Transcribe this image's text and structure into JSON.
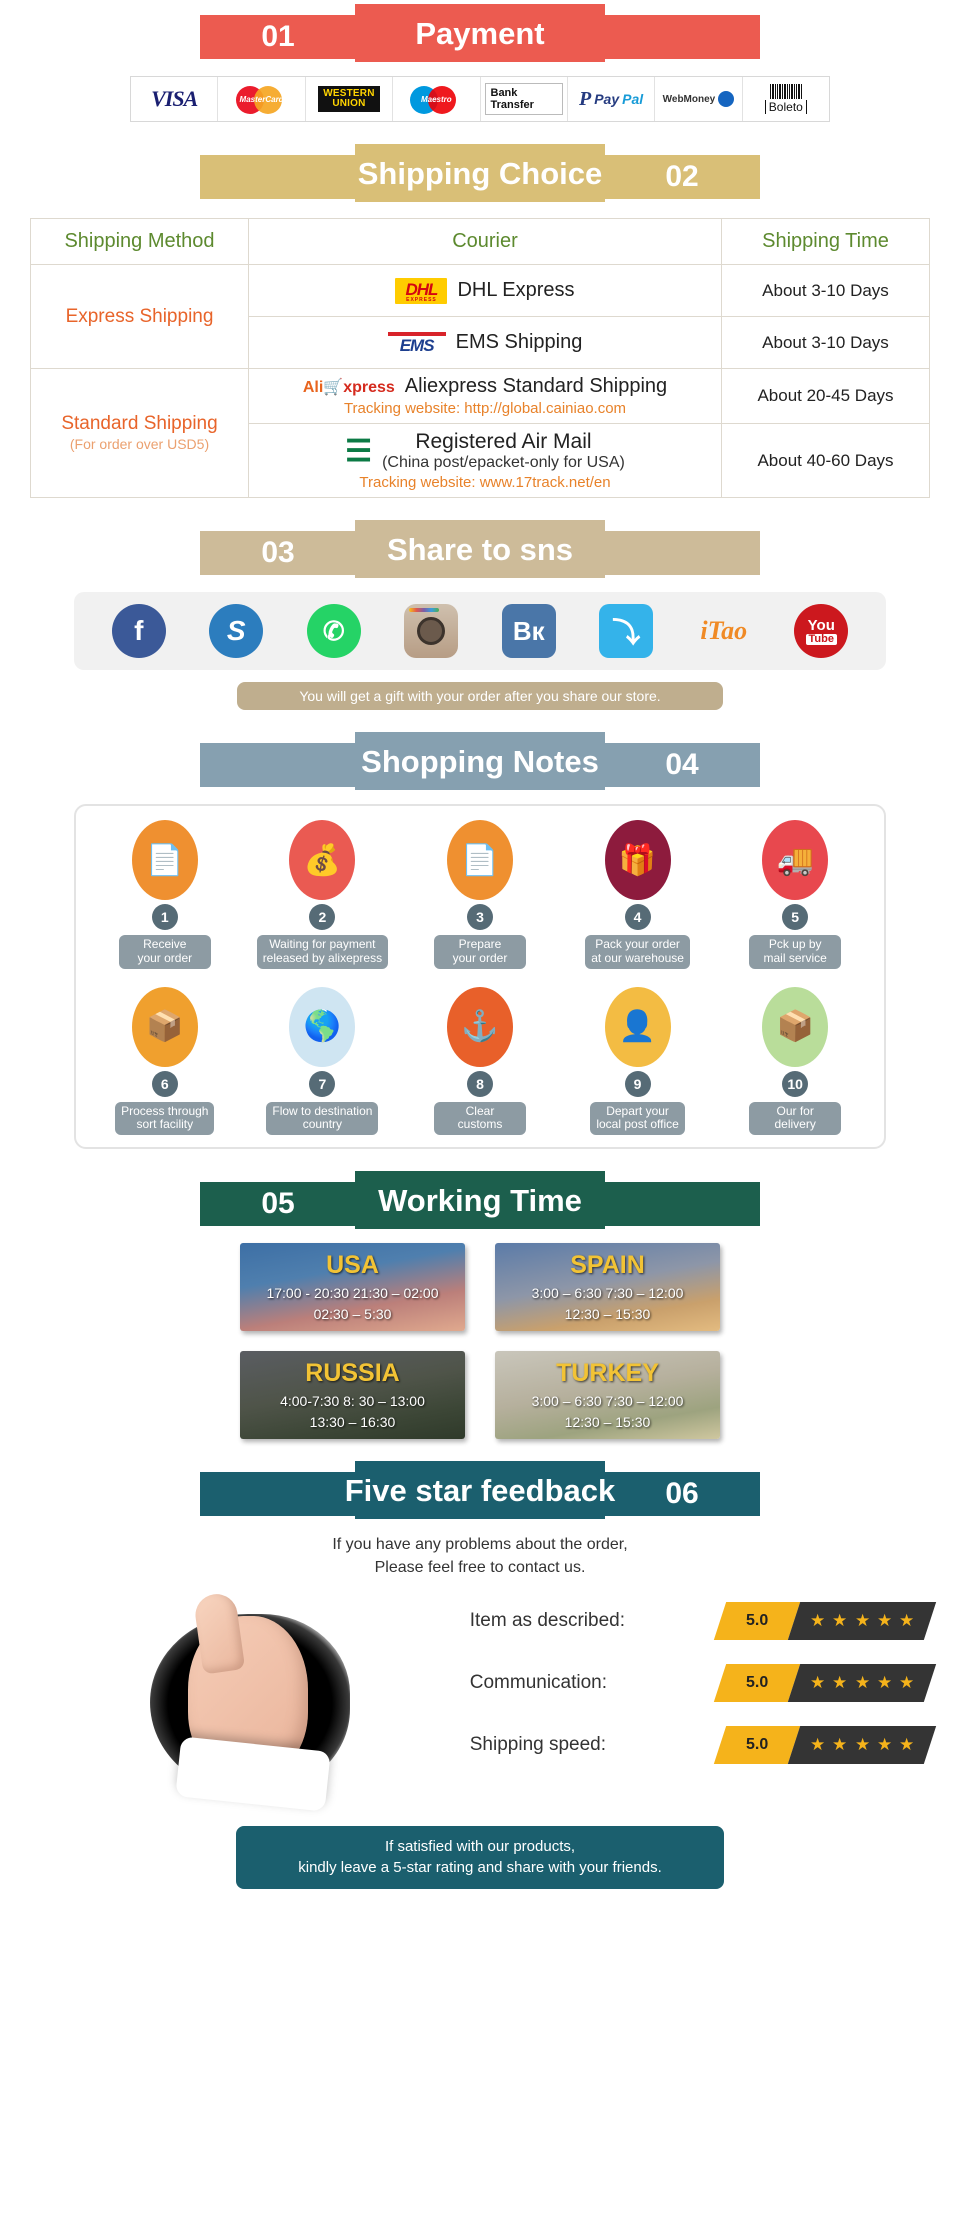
{
  "sections": {
    "payment": {
      "number": "01",
      "title": "Payment",
      "num_side": "left"
    },
    "shipping": {
      "number": "02",
      "title": "Shipping Choice",
      "num_side": "right"
    },
    "share": {
      "number": "03",
      "title": "Share to sns",
      "num_side": "left"
    },
    "notes": {
      "number": "04",
      "title": "Shopping Notes",
      "num_side": "right"
    },
    "working": {
      "number": "05",
      "title": "Working Time",
      "num_side": "left"
    },
    "feedback": {
      "number": "06",
      "title": "Five star feedback",
      "num_side": "right"
    }
  },
  "payment_methods": [
    {
      "name": "Visa",
      "label": "VISA"
    },
    {
      "name": "MasterCard",
      "label": "MasterCard"
    },
    {
      "name": "Western Union",
      "label": "WESTERN",
      "label2": "UNION"
    },
    {
      "name": "Maestro",
      "label": "Maestro"
    },
    {
      "name": "Bank Transfer",
      "label": "Bank Transfer"
    },
    {
      "name": "PayPal",
      "label": "PayPal",
      "mark": "P",
      "label_a": "Pay",
      "label_b": "Pal"
    },
    {
      "name": "WebMoney",
      "label": "WebMoney"
    },
    {
      "name": "Boleto",
      "label": "Boleto"
    }
  ],
  "shipping_table": {
    "headers": {
      "method": "Shipping Method",
      "courier": "Courier",
      "time": "Shipping Time"
    },
    "rows": [
      {
        "method": "Express Shipping",
        "method_sub": "",
        "courier": "DHL Express",
        "logo": "dhl-logo",
        "logo_text": "DHL",
        "logo_sub": "EXPRESS",
        "time": "About 3-10 Days"
      },
      {
        "method": "",
        "method_sub": "",
        "courier": "EMS Shipping",
        "logo": "ems-logo",
        "logo_text": "EMS",
        "time": "About 3-10 Days"
      },
      {
        "method": "Standard Shipping",
        "method_sub": "(For order over USD5)",
        "courier": "Aliexpress Standard Shipping",
        "logo": "aliexpress-logo",
        "logo_a": "Ali",
        "logo_b": "xpress",
        "tracking": "Tracking website: http://global.cainiao.com",
        "time": "About 20-45 Days"
      },
      {
        "method": "",
        "method_sub": "",
        "courier": "Registered Air Mail",
        "courier_sub": "(China post/epacket-only for USA)",
        "logo": "china-post-logo",
        "tracking": "Tracking website: www.17track.net/en",
        "time": "About 40-60 Days"
      }
    ]
  },
  "social": {
    "items": [
      {
        "name": "facebook",
        "glyph": "f"
      },
      {
        "name": "skype",
        "glyph": "S"
      },
      {
        "name": "whatsapp",
        "glyph": "✆"
      },
      {
        "name": "instagram",
        "glyph": ""
      },
      {
        "name": "vk",
        "glyph": "Вк"
      },
      {
        "name": "twitter",
        "glyph": "⤵"
      },
      {
        "name": "itao",
        "glyph": "iTao"
      },
      {
        "name": "youtube",
        "glyph": "You",
        "glyph2": "Tube"
      }
    ],
    "gift_note": "You will get a gift with your order after you share our store."
  },
  "shopping_notes": {
    "steps": [
      {
        "num": "1",
        "label": "Receive\nyour order",
        "icon": "document-icon",
        "color": "#ef9030"
      },
      {
        "num": "2",
        "label": "Waiting for payment\nreleased by alixepress",
        "icon": "money-bag-icon",
        "color": "#ea5a52"
      },
      {
        "num": "3",
        "label": "Prepare\nyour order",
        "icon": "document-icon",
        "color": "#ef9030"
      },
      {
        "num": "4",
        "label": "Pack your order\nat our warehouse",
        "icon": "gift-box-icon",
        "color": "#8d1b3d"
      },
      {
        "num": "5",
        "label": "Pck up by\nmail service",
        "icon": "mail-truck-icon",
        "color": "#e8484e"
      },
      {
        "num": "6",
        "label": "Process through\nsort facility",
        "icon": "hand-truck-icon",
        "color": "#f0a02e"
      },
      {
        "num": "7",
        "label": "Flow to destination\ncountry",
        "icon": "globe-icon",
        "color": "#cfe5f2"
      },
      {
        "num": "8",
        "label": "Clear\ncustoms",
        "icon": "anchor-icon",
        "color": "#e8602a"
      },
      {
        "num": "9",
        "label": "Depart your\nlocal post office",
        "icon": "postman-icon",
        "color": "#f3bc43"
      },
      {
        "num": "10",
        "label": "Our for\ndelivery",
        "icon": "parcel-icon",
        "color": "#b9dd9a"
      }
    ]
  },
  "working_time": {
    "cards": [
      {
        "country": "USA",
        "line1": "17:00  -  20:30   21:30  –  02:00",
        "line2": "02:30  –  5:30",
        "bg": "bg-usa"
      },
      {
        "country": "SPAIN",
        "line1": "3:00  –  6:30   7:30  –  12:00",
        "line2": "12:30  –  15:30",
        "bg": "bg-spain"
      },
      {
        "country": "RUSSIA",
        "line1": "4:00-7:30   8:  30  –  13:00",
        "line2": "13:30  –  16:30",
        "bg": "bg-russia"
      },
      {
        "country": "TURKEY",
        "line1": "3:00  –  6:30   7:30  –  12:00",
        "line2": "12:30  –  15:30",
        "bg": "bg-turkey"
      }
    ]
  },
  "feedback": {
    "intro_line1": "If you have any problems about the order,",
    "intro_line2": "Please feel free to contact us.",
    "ratings": [
      {
        "label": "Item as described:",
        "score": "5.0",
        "stars": 5
      },
      {
        "label": "Communication:",
        "score": "5.0",
        "stars": 5
      },
      {
        "label": "Shipping speed:",
        "score": "5.0",
        "stars": 5
      }
    ],
    "final_line1": "If satisfied with our products,",
    "final_line2": "kindly leave a 5-star rating and share with your friends."
  },
  "colors": {
    "payment_red": "#ec5b50",
    "shipping_gold": "#d9bf77",
    "share_tan": "#cdbb99",
    "notes_slate": "#86a0b0",
    "working_green": "#1c5f4d",
    "feedback_teal": "#1b5f6e",
    "star_yellow": "#f5b31b",
    "accent_orange": "#e8642a",
    "header_green": "#5d8a2f"
  }
}
